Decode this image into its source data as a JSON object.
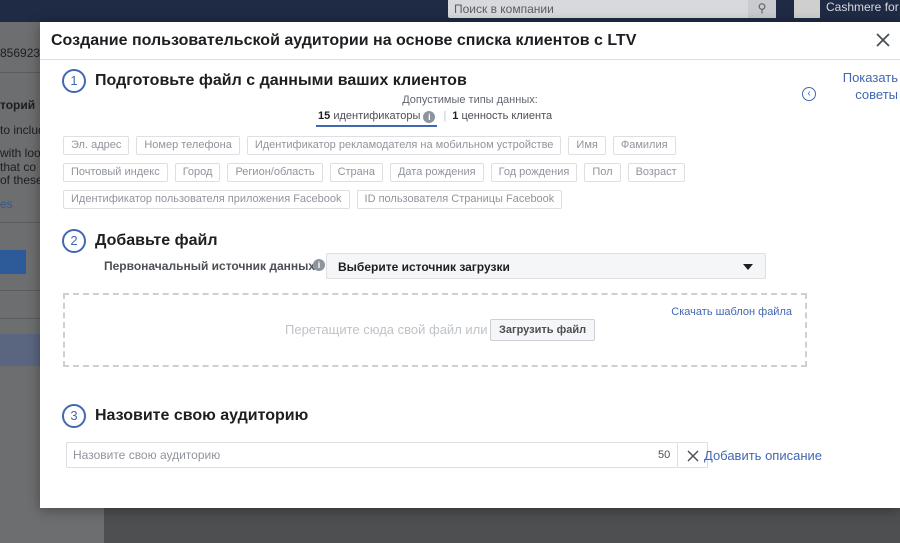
{
  "background": {
    "search_placeholder": "Поиск в компании",
    "user_name": "Cashmere for m",
    "left_fragments": [
      "856923",
      "торий",
      "to includ",
      "with loo",
      "that co",
      "of these",
      "es"
    ]
  },
  "modal": {
    "title": "Создание пользовательской аудитории на основе списка клиентов с LTV",
    "tips_label_line1": "Показать",
    "tips_label_line2": "советы"
  },
  "step1": {
    "number": "1",
    "title": "Подготовьте файл с данными ваших клиентов",
    "types_caption": "Допустимые типы данных:",
    "identifiers_count": "15",
    "identifiers_label": "идентификаторы",
    "ltv_count": "1",
    "ltv_label": "ценность клиента",
    "chips_row1": [
      "Эл. адрес",
      "Номер телефона",
      "Идентификатор рекламодателя на мобильном устройстве",
      "Имя",
      "Фамилия"
    ],
    "chips_row2": [
      "Почтовый индекс",
      "Город",
      "Регион/область",
      "Страна",
      "Дата рождения",
      "Год рождения",
      "Пол",
      "Возраст"
    ],
    "chips_row3": [
      "Идентификатор пользователя приложения Facebook",
      "ID пользователя Страницы Facebook"
    ]
  },
  "step2": {
    "number": "2",
    "title": "Добавьте файл",
    "source_label": "Первоначальный источник данных",
    "source_select_value": "Выберите источник загрузки",
    "template_link": "Скачать шаблон файла",
    "drop_text": "Перетащите сюда свой файл или",
    "upload_button": "Загрузить файл"
  },
  "step3": {
    "number": "3",
    "title": "Назовите свою аудиторию",
    "name_placeholder": "Назовите свою аудиторию",
    "char_limit": "50",
    "add_description": "Добавить описание"
  },
  "colors": {
    "accent": "#4267b2",
    "overlay": "#4a4b4d",
    "border": "#dddfe2"
  }
}
